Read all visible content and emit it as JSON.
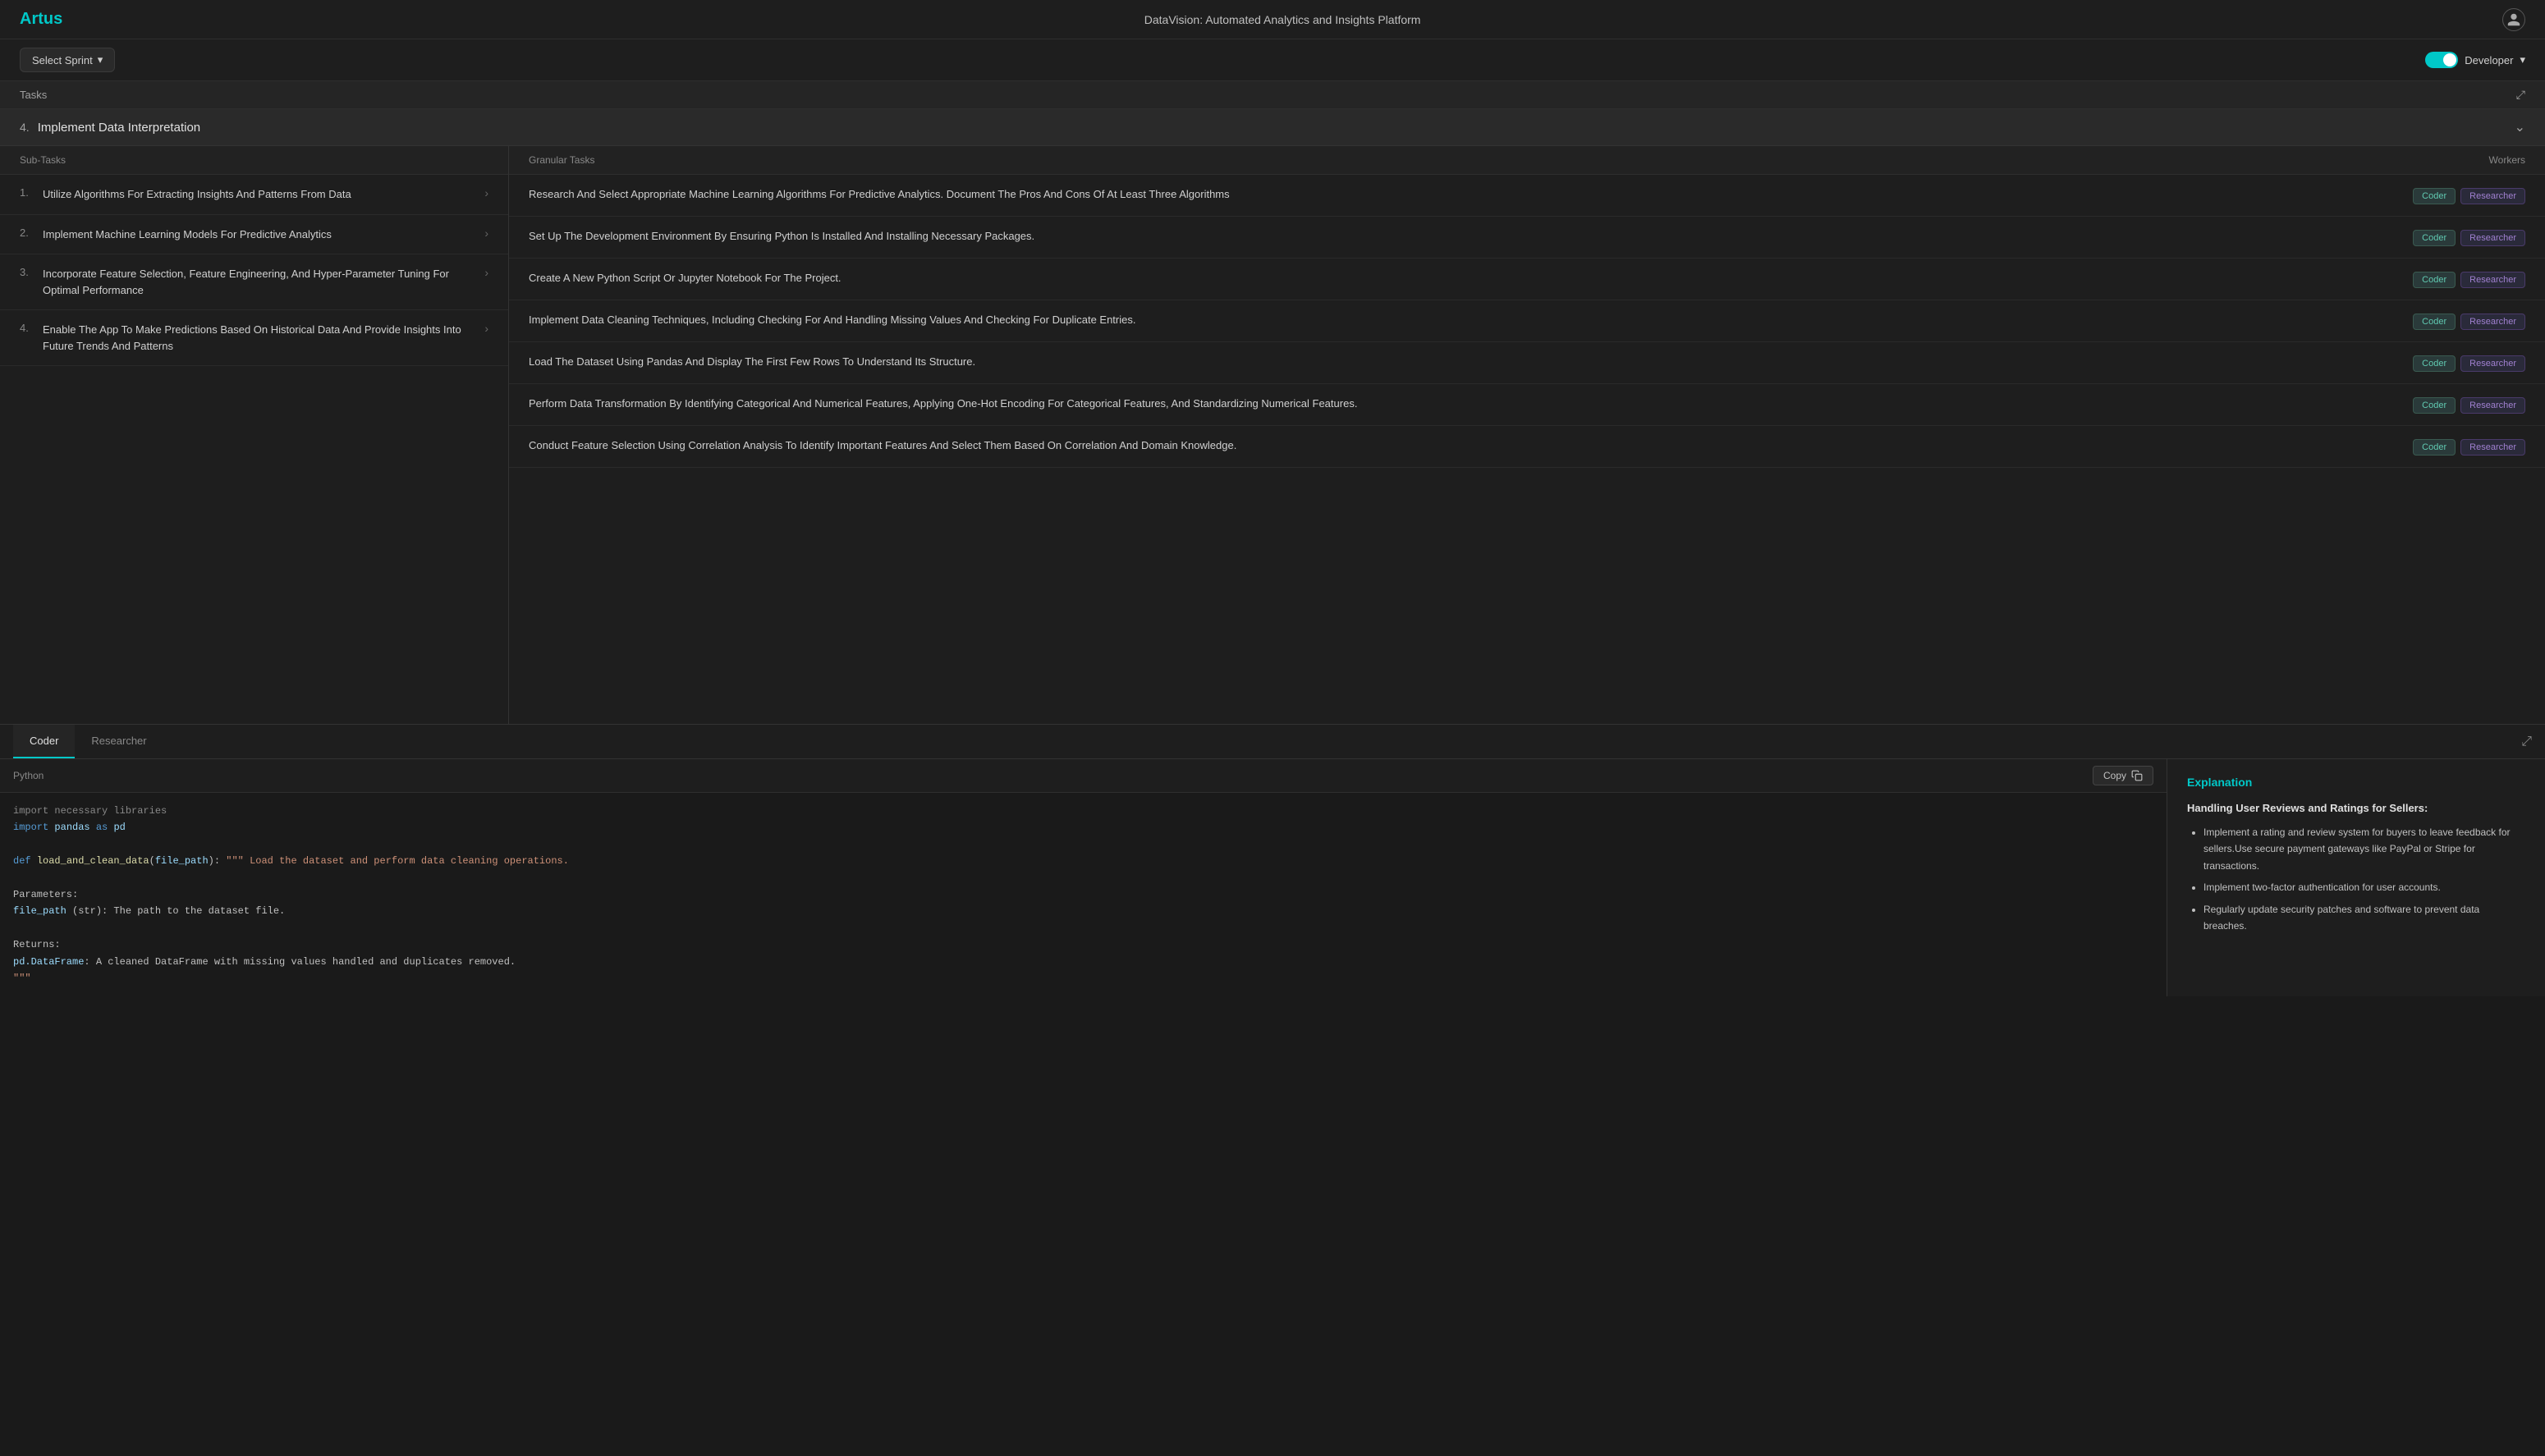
{
  "header": {
    "logo": "Artus",
    "title": "DataVision: Automated Analytics and Insights Platform",
    "user_icon": "👤"
  },
  "toolbar": {
    "sprint_label": "Select Sprint",
    "developer_label": "Developer",
    "developer_toggle_state": true
  },
  "tasks_section": {
    "label": "Tasks",
    "expand_icon": "⤢",
    "task_number": "4.",
    "task_title": "Implement Data Interpretation",
    "chevron_icon": "⌄"
  },
  "subtasks": {
    "header": "Sub-Tasks",
    "items": [
      {
        "num": "1.",
        "text": "Utilize Algorithms For Extracting Insights And Patterns From Data"
      },
      {
        "num": "2.",
        "text": "Implement Machine Learning Models For Predictive Analytics"
      },
      {
        "num": "3.",
        "text": "Incorporate Feature Selection, Feature Engineering, And Hyper-Parameter Tuning For Optimal Performance"
      },
      {
        "num": "4.",
        "text": "Enable The App To Make Predictions Based On Historical Data And Provide Insights Into Future Trends And Patterns"
      }
    ]
  },
  "granular": {
    "header": "Granular Tasks",
    "workers_header": "Workers",
    "rows": [
      {
        "text": "Research And Select Appropriate Machine Learning Algorithms For Predictive Analytics. Document The Pros And Cons Of At Least Three Algorithms",
        "workers": [
          "Coder",
          "Researcher"
        ]
      },
      {
        "text": "Set Up The Development Environment By Ensuring Python Is Installed And Installing Necessary Packages.",
        "workers": [
          "Coder",
          "Researcher"
        ]
      },
      {
        "text": "Create A New Python Script Or Jupyter Notebook For The Project.",
        "workers": [
          "Coder",
          "Researcher"
        ]
      },
      {
        "text": "Implement Data Cleaning Techniques, Including Checking For And Handling Missing Values And Checking For Duplicate Entries.",
        "workers": [
          "Coder",
          "Researcher"
        ]
      },
      {
        "text": "Load The Dataset Using Pandas And Display The First Few Rows To Understand Its Structure.",
        "workers": [
          "Coder",
          "Researcher"
        ]
      },
      {
        "text": "Perform Data Transformation By Identifying Categorical And Numerical Features, Applying One-Hot Encoding For Categorical Features, And Standardizing Numerical Features.",
        "workers": [
          "Coder",
          "Researcher"
        ]
      },
      {
        "text": "Conduct Feature Selection Using Correlation Analysis To Identify Important Features And Select Them Based On Correlation And Domain Knowledge.",
        "workers": [
          "Coder",
          "Researcher"
        ]
      }
    ]
  },
  "bottom": {
    "tabs": [
      "Coder",
      "Researcher"
    ],
    "active_tab": "Coder",
    "code_lang": "Python",
    "copy_button": "Copy",
    "explanation_label": "Explanation",
    "explanation_heading": "Handling User Reviews and Ratings for Sellers:",
    "explanation_items": [
      "Implement a rating and review system for buyers to leave feedback for sellers.Use secure payment gateways like PayPal or Stripe for transactions.",
      "Implement two-factor authentication for user accounts.",
      "Regularly update security patches and software to prevent data breaches."
    ],
    "code_lines": [
      "import necessary libraries",
      "import pandas as pd",
      "",
      "def load_and_clean_data(file_path): \"\"\" Load the dataset and perform data cleaning operations.",
      "",
      "Parameters:",
      "file_path (str): The path to the dataset file.",
      "",
      "Returns:",
      "pd.DataFrame: A cleaned DataFrame with missing values handled and duplicates removed.",
      "\"\"\""
    ]
  }
}
